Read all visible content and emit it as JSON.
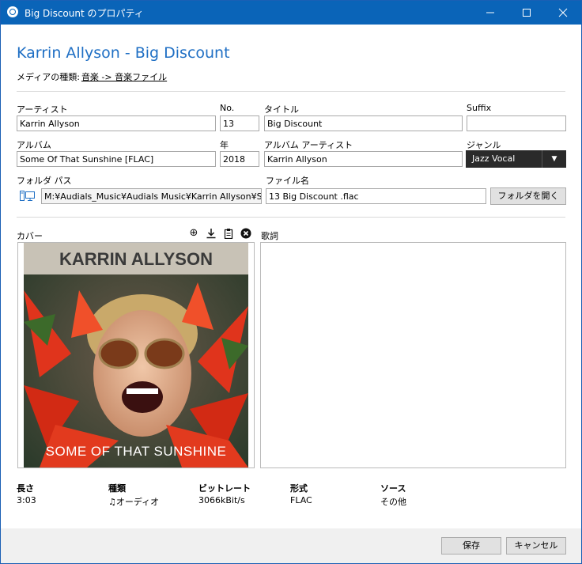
{
  "window": {
    "title": "Big Discount のプロパティ"
  },
  "header": {
    "title": "Karrin Allyson - Big Discount",
    "media_type_label": "メディアの種類:",
    "media_type_value": "音楽 -> 音楽ファイル"
  },
  "fields": {
    "artist_label": "アーティスト",
    "artist_value": "Karrin Allyson",
    "no_label": "No.",
    "no_value": "13",
    "title_label": "タイトル",
    "title_value": "Big Discount",
    "suffix_label": "Suffix",
    "suffix_value": "",
    "album_label": "アルバム",
    "album_value": "Some Of That Sunshine [FLAC]",
    "year_label": "年",
    "year_value": "2018",
    "album_artist_label": "アルバム アーティスト",
    "album_artist_value": "Karrin Allyson",
    "genre_label": "ジャンル",
    "genre_value": "Jazz Vocal",
    "folder_label": "フォルダ パス",
    "folder_value": "M:¥Audials_Music¥Audials Music¥Karrin Allyson¥Sor",
    "filename_label": "ファイル名",
    "filename_value": "13 Big Discount .flac",
    "open_folder_button": "フォルダを開く"
  },
  "cover": {
    "label": "カバー",
    "art_top_text": "KARRIN ALLYSON",
    "art_bottom_text": "SOME OF THAT SUNSHINE"
  },
  "lyrics": {
    "label": "歌詞"
  },
  "info": {
    "length_label": "長さ",
    "length_value": "3:03",
    "type_label": "種類",
    "type_value": "オーディオ",
    "bitrate_label": "ビットレート",
    "bitrate_value": "3066kBit/s",
    "format_label": "形式",
    "format_value": "FLAC",
    "source_label": "ソース",
    "source_value": "その他"
  },
  "buttons": {
    "save": "保存",
    "cancel": "キャンセル"
  },
  "colors": {
    "accent": "#1f6fc4",
    "titlebar": "#0a64b8",
    "genre_bg": "#2a2a2a"
  }
}
